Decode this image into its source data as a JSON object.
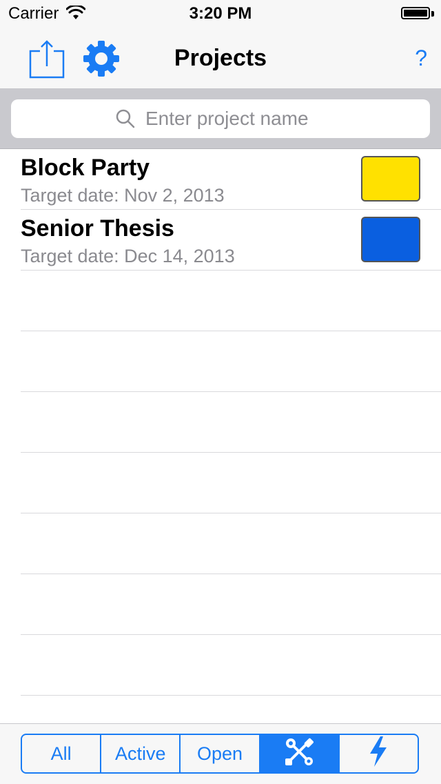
{
  "status_bar": {
    "carrier": "Carrier",
    "time": "3:20 PM"
  },
  "nav": {
    "title": "Projects",
    "help_label": "?",
    "left_icons": [
      "share-icon",
      "gear-icon"
    ]
  },
  "search": {
    "placeholder": "Enter project name",
    "value": ""
  },
  "projects": [
    {
      "name": "Block Party",
      "target": "Target date: Nov 2, 2013",
      "color": "#ffe100"
    },
    {
      "name": "Senior Thesis",
      "target": "Target date: Dec 14, 2013",
      "color": "#0a5fe0"
    }
  ],
  "toolbar": {
    "segments": [
      {
        "label": "All"
      },
      {
        "label": "Active"
      },
      {
        "label": "Open"
      },
      {
        "icon": "tools-icon",
        "selected": true
      },
      {
        "icon": "lightning-icon"
      }
    ]
  },
  "colors": {
    "accent": "#1a7cf4",
    "bar_background": "#f7f7f7",
    "search_background": "#c9c9ce"
  }
}
